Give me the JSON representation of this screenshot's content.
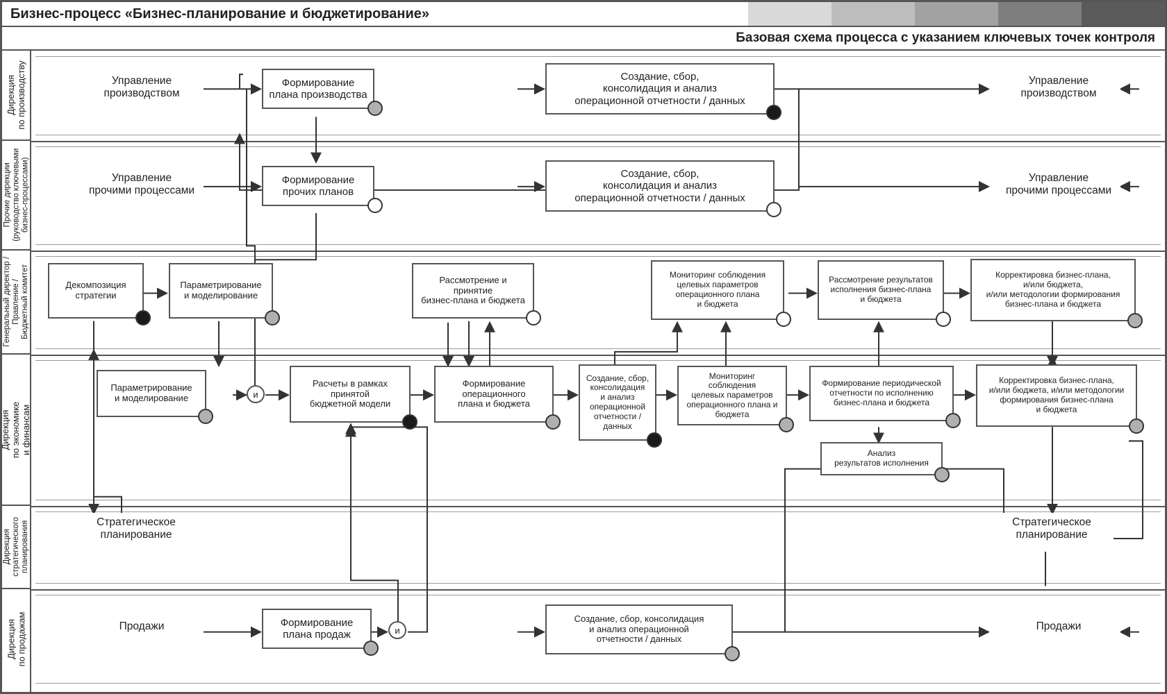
{
  "header": {
    "title": "Бизнес-процесс «Бизнес-планирование и бюджетирование»",
    "subtitle": "Базовая схема процесса с указанием ключевых точек контроля"
  },
  "lanes": [
    {
      "id": "l1",
      "label": "Дирекция\nпо производству"
    },
    {
      "id": "l2",
      "label": "Прочие дирекции\n(руководство ключевыми\nбизнес-процессами)"
    },
    {
      "id": "l3",
      "label": "Генеральный директор /\nПравление /\nБюджетный комитет"
    },
    {
      "id": "l4",
      "label": "Дирекция\nпо экономике\nи финансам"
    },
    {
      "id": "l5",
      "label": "Дирекция\nстратегического\nпланирования"
    },
    {
      "id": "l6",
      "label": "Дирекция\nпо продажам"
    }
  ],
  "boxes": {
    "b1": "Формирование\nплана производства",
    "b2": "Создание, сбор,\nконсолидация и анализ\nоперационной отчетности / данных",
    "b3": "Формирование\nпрочих планов",
    "b4": "Создание, сбор,\nконсолидация и анализ\nоперационной отчетности / данных",
    "b5": "Декомпозиция\nстратегии",
    "b6": "Параметрирование\nи моделирование",
    "b7": "Рассмотрение и принятие\nбизнес-плана и бюджета",
    "b8": "Мониторинг соблюдения\nцелевых параметров\nоперационного плана\nи бюджета",
    "b9": "Рассмотрение результатов\nисполнения бизнес-плана\nи бюджета",
    "b10": "Корректировка бизнес-плана,\nи/или бюджета,\nи/или методологии формирования\nбизнес-плана и бюджета",
    "b11": "Параметрирование\nи моделирование",
    "b12": "Расчеты в рамках\nпринятой\nбюджетной модели",
    "b13": "Формирование\nоперационного\nплана и бюджета",
    "b14": "Создание, сбор,\nконсолидация\nи анализ\nоперационной\nотчетности /\nданных",
    "b15": "Мониторинг соблюдения\nцелевых параметров\nоперационного плана и\nбюджета",
    "b16": "Формирование периодической\nотчетности по исполнению\nбизнес-плана и бюджета",
    "b17": "Анализ\nрезультатов исполнения",
    "b18": "Корректировка бизнес-плана,\nи/или бюджета, и/или методологии\nформирования бизнес-плана\nи бюджета",
    "b19": "Формирование\nплана продаж",
    "b20": "Создание, сбор, консолидация\nи анализ операционной\nотчетности / данных"
  },
  "offpages": {
    "o1": "Управление\nпроизводством",
    "o2": "Управление\nпроизводством",
    "o3": "Управление\nпрочими процессами",
    "o4": "Управление\nпрочими процессами",
    "o5": "Стратегическое\nпланирование",
    "o6": "Стратегическое\nпланирование",
    "o7": "Продажи",
    "o8": "Продажи"
  },
  "gates": {
    "g1": "и",
    "g2": "и"
  }
}
